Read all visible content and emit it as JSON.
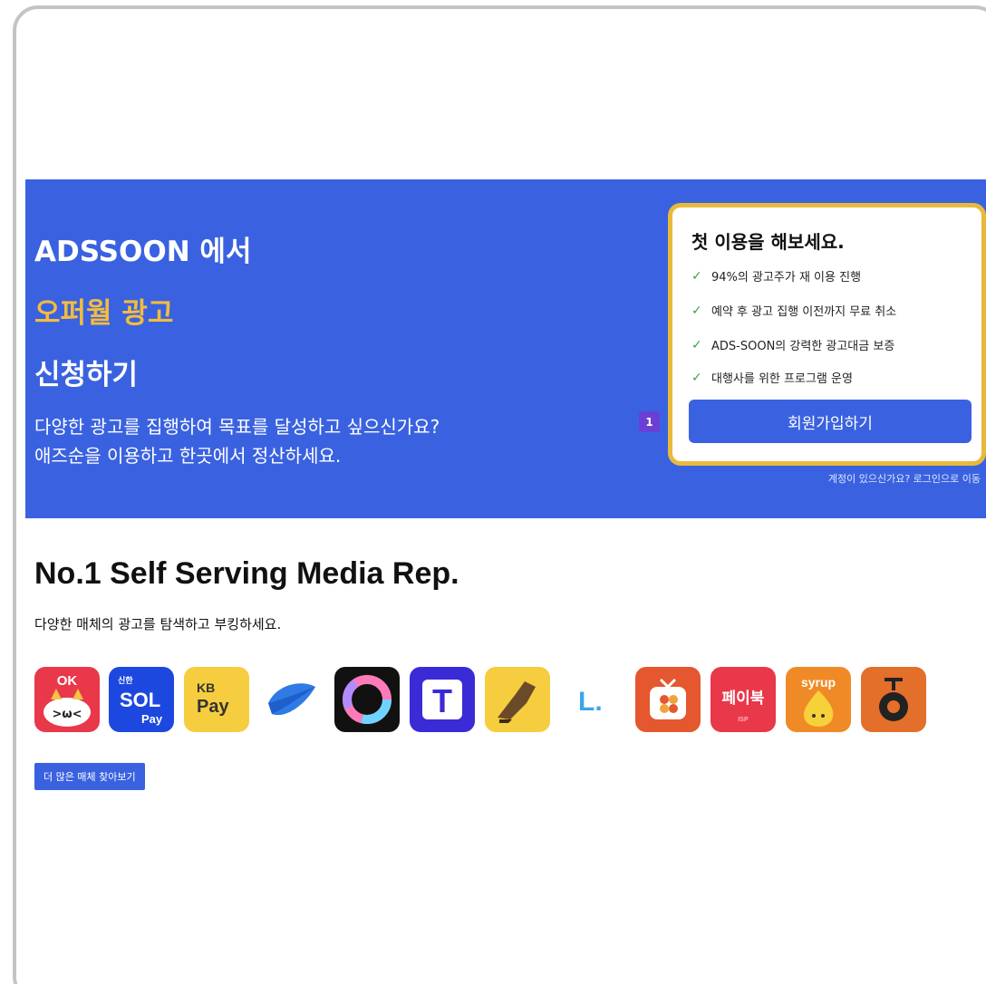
{
  "hero": {
    "line1": "ADSSOON 에서",
    "line2": "오퍼월 광고",
    "line3": "신청하기",
    "sub1": "다양한 광고를 집행하여 목표를 달성하고 싶으신가요?",
    "sub2": "애즈순을 이용하고 한곳에서 정산하세요.",
    "badge": "1"
  },
  "card": {
    "title": "첫 이용을 해보세요.",
    "features": [
      "94%의 광고주가 재 이용 진행",
      "예약 후 광고 집행 이전까지 무료 취소",
      "ADS-SOON의 강력한 광고대금 보증",
      "대행사를 위한 프로그램 운영"
    ],
    "signup_label": "회원가입하기",
    "login_link": "계정이 있으신가요? 로그인으로 이동"
  },
  "media": {
    "title": "No.1 Self Serving Media Rep.",
    "subtitle": "다양한 매체의 광고를 탐색하고 부킹하세요.",
    "apps": [
      {
        "name": "ok-cashbag-icon",
        "text": "OK"
      },
      {
        "name": "sol-pay-icon",
        "text": "신한",
        "text2": "SOL",
        "text3": "Pay"
      },
      {
        "name": "kb-pay-icon",
        "text": "KB",
        "text2": "Pay"
      },
      {
        "name": "blue-leaf-icon"
      },
      {
        "name": "ring-icon"
      },
      {
        "name": "t-icon",
        "text": "T"
      },
      {
        "name": "sneaker-icon"
      },
      {
        "name": "l-point-icon",
        "text": "L."
      },
      {
        "name": "tv-icon"
      },
      {
        "name": "paybook-icon",
        "text": "페이북",
        "text2": "ISP"
      },
      {
        "name": "syrup-icon",
        "text": "syrup"
      },
      {
        "name": "orange-bell-icon"
      }
    ],
    "more_label": "더 많은 매체 찾아보기"
  },
  "colors": {
    "hero_bg": "#3a62e0",
    "accent_gold": "#f2bc3d",
    "card_border": "#e8b93a",
    "check": "#3aa24a"
  }
}
